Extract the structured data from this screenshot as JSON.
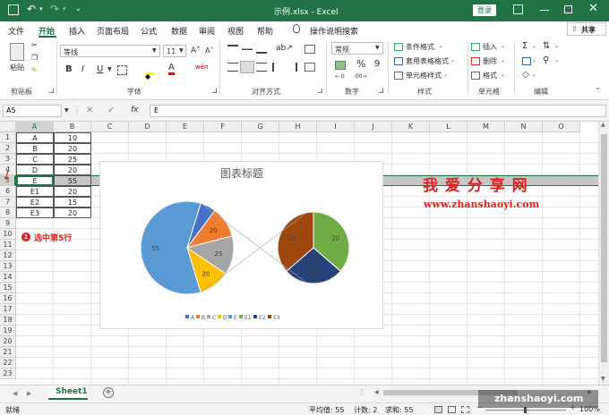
{
  "window": {
    "title": "示例.xlsx  -  Excel",
    "login_label": "登录"
  },
  "ribbon_tabs": [
    "文件",
    "开始",
    "插入",
    "页面布局",
    "公式",
    "数据",
    "审阅",
    "视图",
    "帮助"
  ],
  "tell_me": "操作说明搜索",
  "share_label": "共享",
  "ribbon": {
    "clipboard": {
      "paste_label": "粘贴",
      "group": "剪贴板"
    },
    "font": {
      "font_name": "等线",
      "font_size": "11",
      "group": "字体",
      "bold": "B",
      "italic": "I",
      "underline": "U",
      "grow": "A˄",
      "shrink": "A˅",
      "wen": "wén"
    },
    "alignment": {
      "group": "对齐方式"
    },
    "number": {
      "format": "常规",
      "group": "数字",
      "percent": "%",
      "comma": "9"
    },
    "styles": {
      "cond": "条件格式",
      "table": "套用表格格式",
      "cell": "单元格样式",
      "group": "样式"
    },
    "cells": {
      "insert": "插入",
      "delete": "删除",
      "format": "格式",
      "group": "单元格"
    },
    "editing": {
      "group": "编辑"
    }
  },
  "formula_bar": {
    "name_box": "A5",
    "content": "E",
    "fx": "fx"
  },
  "columns": [
    "A",
    "B",
    "C",
    "D",
    "E",
    "F",
    "G",
    "H",
    "I",
    "J",
    "K",
    "L",
    "M",
    "N",
    "O"
  ],
  "rows": [
    "1",
    "2",
    "3",
    "4",
    "5",
    "6",
    "7",
    "8",
    "9",
    "10",
    "11",
    "12",
    "13",
    "14",
    "15",
    "16",
    "17",
    "18",
    "19",
    "20",
    "21",
    "22",
    "23"
  ],
  "table": [
    [
      "A",
      "10"
    ],
    [
      "B",
      "20"
    ],
    [
      "C",
      "25"
    ],
    [
      "D",
      "20"
    ],
    [
      "E",
      "55"
    ],
    [
      "E1",
      "20"
    ],
    [
      "E2",
      "15"
    ],
    [
      "E3",
      "20"
    ]
  ],
  "selected_row": 5,
  "annotation": {
    "badge": "1",
    "text": "选中第5行"
  },
  "watermark": {
    "title": "我 爱 分 享 网",
    "url": "www.zhanshaoyi.com",
    "footer": "zhanshaoyi.com"
  },
  "chart_data": {
    "type": "pie",
    "title": "图表标题",
    "categories": [
      "A",
      "B",
      "C",
      "D",
      "E",
      "E1",
      "E2",
      "E3"
    ],
    "values": [
      10,
      20,
      25,
      20,
      55,
      20,
      15,
      20
    ],
    "colors": [
      "#4472c4",
      "#ed7d31",
      "#a5a5a5",
      "#ffc000",
      "#5b9bd5",
      "#70ad47",
      "#264478",
      "#9e480e"
    ],
    "series_name": "Sheet1!B1:B8",
    "data_labels": [
      "",
      "20",
      "25",
      "20",
      "55",
      "20",
      "15",
      "20"
    ],
    "legend": "bottom"
  },
  "sheet_tab": "Sheet1",
  "status": {
    "ready": "就绪",
    "average": "平均值: 55",
    "count": "计数: 2",
    "sum": "求和: 55",
    "zoom": "100%"
  }
}
